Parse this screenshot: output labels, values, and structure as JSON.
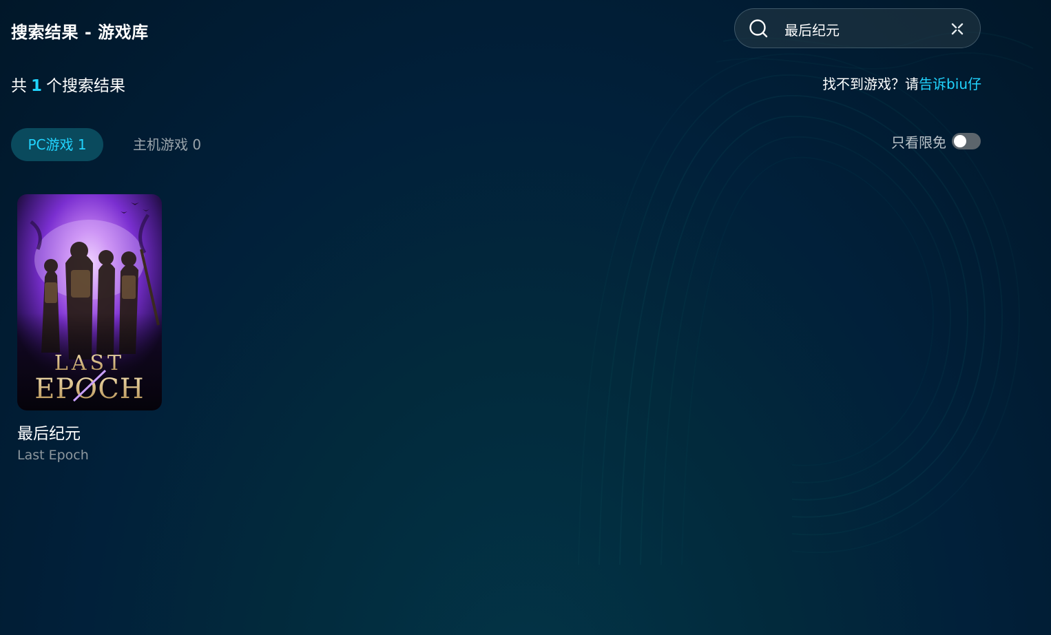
{
  "header": {
    "title": "搜索结果 - 游戏库"
  },
  "search": {
    "value": "最后纪元",
    "icon": "search-icon",
    "clear_icon": "close-icon"
  },
  "results": {
    "prefix": "共",
    "count": "1",
    "suffix": "个搜索结果"
  },
  "feedback": {
    "text": "找不到游戏？请",
    "link": "告诉biu仔"
  },
  "tabs": [
    {
      "label": "PC游戏 1",
      "active": true
    },
    {
      "label": "主机游戏 0",
      "active": false
    }
  ],
  "filter": {
    "label": "只看限免",
    "enabled": false
  },
  "games": [
    {
      "name_cn": "最后纪元",
      "name_en": "Last Epoch",
      "cover_text_top": "LAST",
      "cover_text_bottom": "EPOCH"
    }
  ],
  "colors": {
    "accent": "#21d4ff",
    "background": "#01203a",
    "tab_active_bg": "#0a4a5d",
    "muted_text": "#9aa4ab"
  }
}
